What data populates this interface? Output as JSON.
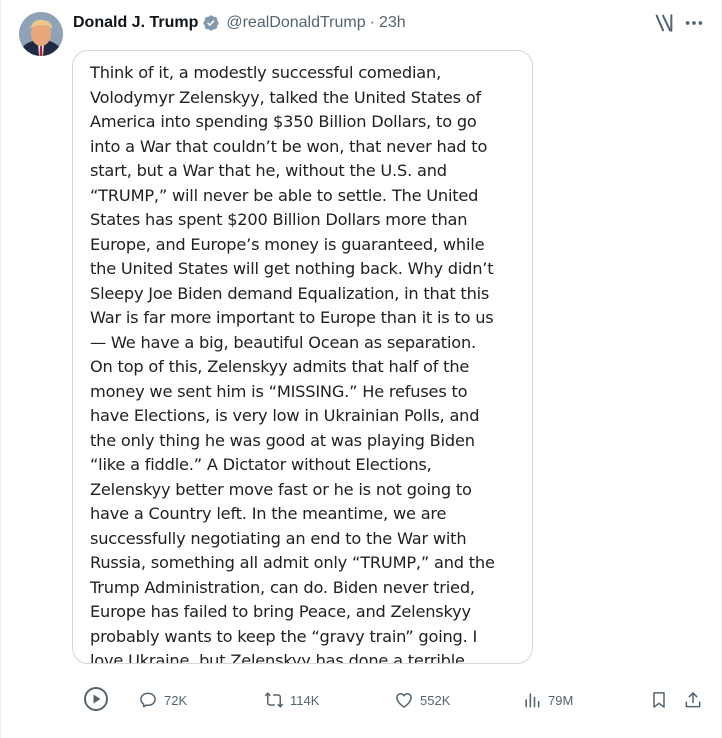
{
  "post": {
    "display_name": "Donald J. Trump",
    "handle": "@realDonaldTrump",
    "separator": "·",
    "time": "23h",
    "text": "Think of it, a modestly successful comedian,\nVolodymyr Zelenskyy, talked the United States of\nAmerica into spending $350 Billion Dollars, to go\ninto a War that couldn’t be won, that never had to\nstart, but a War that he, without the U.S. and\n“TRUMP,” will never be able to settle. The United\nStates has spent $200 Billion Dollars more than\nEurope, and Europe’s money is guaranteed, while\nthe United States will get nothing back. Why didn’t\nSleepy Joe Biden demand Equalization, in that this\nWar is far more important to Europe than it is to us\n— We have a big, beautiful Ocean as separation.\nOn top of this, Zelenskyy admits that half of the\nmoney we sent him is “MISSING.” He refuses to\nhave Elections, is very low in Ukrainian Polls, and\nthe only thing he was good at was playing Biden\n“like a fiddle.” A Dictator without Elections,\nZelenskyy better move fast or he is not going to\nhave a Country left. In the meantime, we are\nsuccessfully negotiating an end to the War with\nRussia, something all admit only “TRUMP,” and the\nTrump Administration, can do. Biden never tried,\nEurope has failed to bring Peace, and Zelenskyy\nprobably wants to keep the “gravy train” going. I\nlove Ukraine, but Zelenskyy has done a terrible"
  },
  "actions": {
    "replies": "72K",
    "reposts": "114K",
    "likes": "552K",
    "views": "79M"
  },
  "icons": {
    "verified": "verified-badge-icon",
    "grok": "grok-icon",
    "more": "more-icon",
    "play": "play-icon",
    "reply": "reply-icon",
    "repost": "repost-icon",
    "like": "heart-icon",
    "views": "views-icon",
    "bookmark": "bookmark-icon",
    "share": "share-icon"
  },
  "colors": {
    "text": "#0f1419",
    "muted": "#536471",
    "verified_badge": "#829aab",
    "border": "#cfd9de"
  }
}
